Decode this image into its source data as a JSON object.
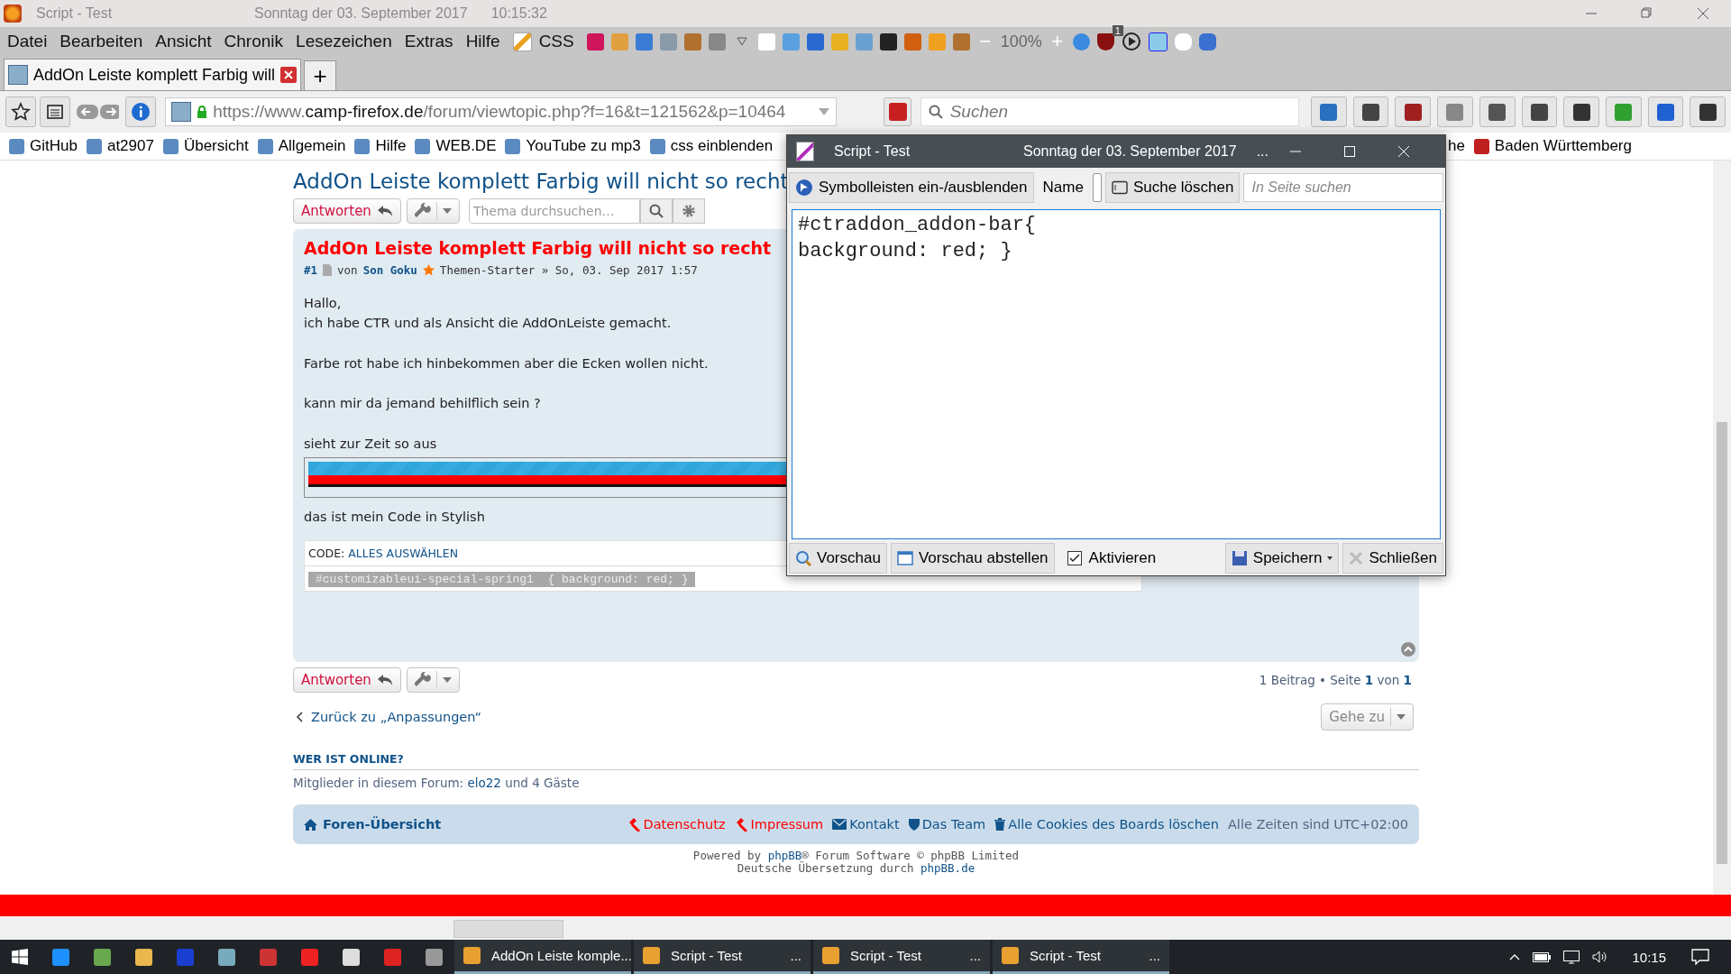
{
  "window": {
    "title": "Script - Test",
    "date": "Sonntag der 03. September 2017",
    "time": "10:15:32"
  },
  "menu": [
    "Datei",
    "Bearbeiten",
    "Ansicht",
    "Chronik",
    "Lesezeichen",
    "Extras",
    "Hilfe"
  ],
  "menu_tools": {
    "css": "CSS",
    "zoom_out": "−",
    "zoom": "100%",
    "zoom_in": "+",
    "badge": "1"
  },
  "tabs": [
    {
      "label": "AddOn Leiste komplett Farbig will",
      "selected": true
    }
  ],
  "new_tab": "+",
  "url": {
    "scheme": "https://www.",
    "host": "camp-firefox.de",
    "path": "/forum/viewtopic.php?f=16&t=121562&p=10464"
  },
  "search": {
    "placeholder": "Suchen"
  },
  "bookmarks": [
    {
      "label": "GitHub"
    },
    {
      "label": "at2907"
    },
    {
      "label": "Übersicht"
    },
    {
      "label": "Allgemein"
    },
    {
      "label": "Hilfe"
    },
    {
      "label": "WEB.DE"
    },
    {
      "label": "YouTube zu mp3"
    },
    {
      "label": "css einblenden"
    }
  ],
  "bookmarks_right": [
    {
      "label": "he"
    },
    {
      "label": "Baden Württemberg"
    }
  ],
  "forum": {
    "title": "AddOn Leiste komplett Farbig will nicht so recht",
    "reply": "Antworten",
    "topic_search": {
      "placeholder": "Thema durchsuchen…"
    },
    "post": {
      "title": "AddOn Leiste komplett Farbig will nicht so recht",
      "number": "#1",
      "by": "von",
      "author": "Son Goku",
      "meta": "Themen-Starter » So, 03. Sep 2017 1:57",
      "paragraphs": [
        "Hallo,\nich habe CTR und als Ansicht die AddOnLeiste gemacht.",
        "Farbe rot habe ich hinbekommen aber die Ecken wollen nicht.",
        "kann mir da jemand behilflich sein ?",
        "sieht zur Zeit so aus"
      ],
      "after_image": "das ist mein Code in Stylish",
      "code_label": "CODE:",
      "select_all": "ALLES AUSWÄHLEN",
      "code": "#customizableui-special-spring1  { background: red; }"
    },
    "reply_bottom": "Antworten",
    "pagination": "1 Beitrag • Seite **1** von **1**",
    "back": "Zurück zu „Anpassungen“",
    "jump": "Gehe zu",
    "online_heading": "WER IST ONLINE?",
    "online_before": "Mitglieder in diesem Forum: ",
    "online_user": "elo22",
    "online_after": " und 4 Gäste",
    "footer_home": "Foren-Übersicht",
    "footer_links": [
      {
        "label": "Datenschutz",
        "kind": "gavel",
        "color": "#ff0000"
      },
      {
        "label": "Impressum",
        "kind": "gavel",
        "color": "#ff0000"
      },
      {
        "label": "Kontakt",
        "kind": "mail",
        "color": "#105289"
      },
      {
        "label": "Das Team",
        "kind": "shield",
        "color": "#105289"
      },
      {
        "label": "Alle Cookies des Boards löschen",
        "kind": "trash",
        "color": "#105289"
      }
    ],
    "timezone": "Alle Zeiten sind UTC+02:00",
    "powered_before": "Powered by ",
    "powered_link": "phpBB",
    "powered_after": "® Forum Software © phpBB Limited",
    "translation_before": "Deutsche Übersetzung durch ",
    "translation_link": "phpBB.de"
  },
  "dialog": {
    "title": "Script - Test",
    "date": "Sonntag der 03. September 2017",
    "more": "...",
    "toggle": "Symbolleisten ein-/ausblenden",
    "name_label": "Name",
    "clear_search": "Suche löschen",
    "find": {
      "placeholder": "In Seite suchen"
    },
    "code_lines": [
      "#ctraddon_addon-bar{",
      "background: red; }"
    ],
    "preview": "Vorschau",
    "stop_preview": "Vorschau abstellen",
    "activate": {
      "label": "Aktivieren",
      "checked": true
    },
    "save": "Speichern",
    "close": "Schließen"
  },
  "taskbar": {
    "windows": [
      {
        "label": "AddOn Leiste komple..."
      },
      {
        "label": "Script - Test",
        "more": "..."
      },
      {
        "label": "Script - Test",
        "more": "..."
      },
      {
        "label": "Script - Test",
        "more": "..."
      }
    ],
    "clock": "10:15"
  }
}
